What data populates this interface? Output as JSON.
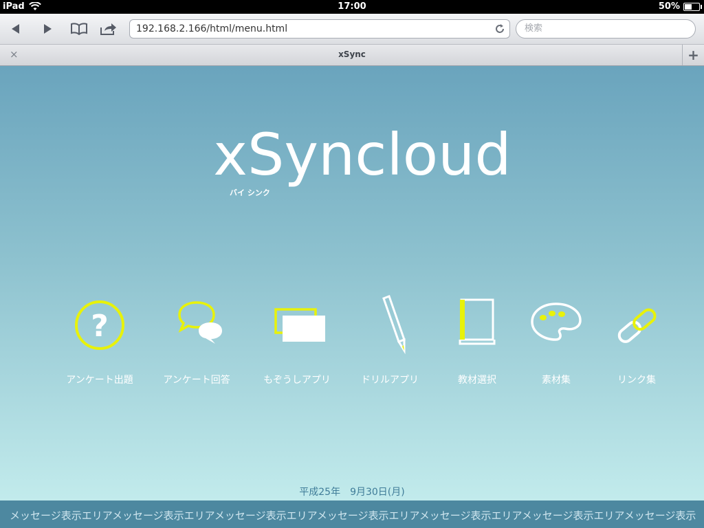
{
  "status_bar": {
    "device": "iPad",
    "time": "17:00",
    "battery": "50%",
    "battery_level": 0.5
  },
  "browser": {
    "url": "192.168.2.166/html/menu.html",
    "search_placeholder": "検索",
    "tab_title": "xSync",
    "tab_close": "×",
    "new_tab": "+"
  },
  "logo": {
    "text": "xSyncloud",
    "subtitle": "バイ シンク"
  },
  "menu": [
    {
      "label": "アンケート出題",
      "icon": "question-icon"
    },
    {
      "label": "アンケート回答",
      "icon": "chat-bubbles-icon"
    },
    {
      "label": "もぞうしアプリ",
      "icon": "papers-icon"
    },
    {
      "label": "ドリルアプリ",
      "icon": "pencil-icon"
    },
    {
      "label": "教材選択",
      "icon": "book-icon"
    },
    {
      "label": "素材集",
      "icon": "palette-icon"
    },
    {
      "label": "リンク集",
      "icon": "link-icon"
    }
  ],
  "date": "平成25年　9月30日(月)",
  "message_bar": "メッセージ表示エリアメッセージ表示エリアメッセージ表示エリアメッセージ表示エリアメッセージ表示エリアメッセージ表示エリアメッセージ表示",
  "colors": {
    "accent_yellow": "#e8f20a",
    "page_top": "#6aa4bd",
    "page_bottom": "#c2ebec",
    "message_bar": "#4d88a0"
  }
}
